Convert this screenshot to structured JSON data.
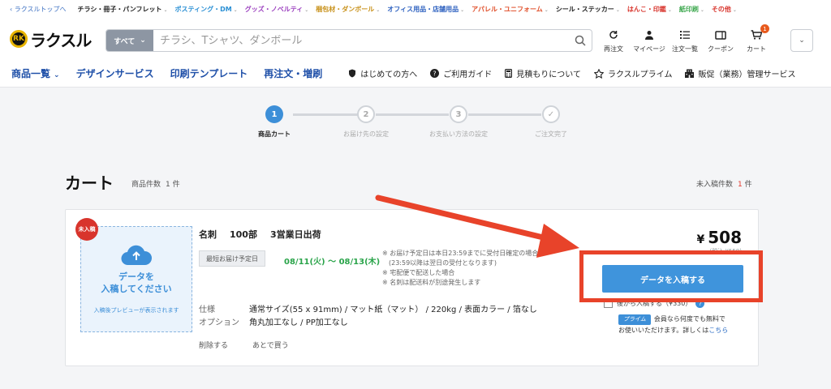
{
  "toplinks": {
    "back": "ラクスルトップへ",
    "items": [
      {
        "label": "チラシ・冊子・パンフレット",
        "color": "#222222"
      },
      {
        "label": "ポスティング・DM",
        "color": "#2a8fd4"
      },
      {
        "label": "グッズ・ノベルティ",
        "color": "#9b3fbf"
      },
      {
        "label": "梱包材・ダンボール",
        "color": "#c8911a"
      },
      {
        "label": "オフィス用品・店舗用品",
        "color": "#2b5fbf"
      },
      {
        "label": "アパレル・ユニフォーム",
        "color": "#e0502b"
      },
      {
        "label": "シール・ステッカー",
        "color": "#222222"
      },
      {
        "label": "はんこ・印鑑",
        "color": "#d8342c"
      },
      {
        "label": "紙印刷",
        "color": "#3ea84f"
      },
      {
        "label": "その他",
        "color": "#d8342c"
      }
    ]
  },
  "header": {
    "logo_mark": "RK",
    "logo_text": "ラクスル",
    "search_category": "すべて",
    "search_placeholder": "チラシ、Tシャツ、ダンボール",
    "icons": [
      {
        "label": "再注文",
        "icon": "refresh-icon"
      },
      {
        "label": "マイページ",
        "icon": "user-icon"
      },
      {
        "label": "注文一覧",
        "icon": "list-icon"
      },
      {
        "label": "クーポン",
        "icon": "coupon-icon"
      },
      {
        "label": "カート",
        "icon": "cart-icon",
        "badge": "1"
      }
    ],
    "dropdown": "⌄"
  },
  "nav": {
    "main": [
      {
        "label": "商品一覧",
        "chevron": "⌄"
      },
      {
        "label": "デザインサービス"
      },
      {
        "label": "印刷テンプレート"
      },
      {
        "label": "再注文・増刷"
      }
    ],
    "sub": [
      {
        "label": "はじめての方へ",
        "icon": "shield-icon"
      },
      {
        "label": "ご利用ガイド",
        "icon": "help-icon"
      },
      {
        "label": "見積もりについて",
        "icon": "calculator-icon"
      },
      {
        "label": "ラクスルプライム",
        "icon": "star-icon"
      },
      {
        "label": "販促（業務）管理サービス",
        "icon": "building-icon"
      }
    ]
  },
  "stepper": [
    {
      "num": "1",
      "label": "商品カート",
      "active": true
    },
    {
      "num": "2",
      "label": "お届け先の設定",
      "active": false
    },
    {
      "num": "3",
      "label": "お支払い方法の設定",
      "active": false
    },
    {
      "num": "✓",
      "label": "ご注文完了",
      "active": false
    }
  ],
  "cart": {
    "title": "カート",
    "count_label": "商品件数",
    "count": "1 件",
    "unsubmitted_label": "未入稿件数",
    "unsubmitted_count": "1",
    "unsubmitted_suffix": "件"
  },
  "item": {
    "stamp": "未入稿",
    "upload_text": "データを\n入稿してください",
    "upload_sub": "入稿後プレビューが表示されます",
    "name": "名刺",
    "qty": "100部",
    "ship": "3営業日出荷",
    "delivery_tag": "最短お届け予定日",
    "delivery_date": "08/11(火) 〜 08/13(木)",
    "notes": [
      "※ お届け予定日は本日23:59までに受付日確定の場合",
      "　(23:59以降は翌日の受付となります)",
      "※ 宅配便で配送した場合",
      "※ 名刺は配送料が別途発生します"
    ],
    "spec_label": "仕様",
    "spec_value": "通常サイズ(55 x 91mm) / マット紙（マット） / 220kg / 表面カラー / 箔なし",
    "option_label": "オプション",
    "option_value": "角丸加工なし / PP加工なし",
    "delete": "削除する",
    "later": "あとで買う",
    "yen": "¥",
    "price": "508",
    "price_sub": "(税込 ¥558)",
    "cta": "データを入稿する",
    "later_submit": "後から入稿する（¥330）",
    "prime_badge": "プライム",
    "prime_text1": "会員なら何度でも無料で",
    "prime_text2": "お使いいただけます。詳しくは",
    "prime_link": "こちら"
  },
  "colors": {
    "accent": "#3f94dc",
    "annotation": "#e8432a",
    "green": "#2aa44a"
  }
}
